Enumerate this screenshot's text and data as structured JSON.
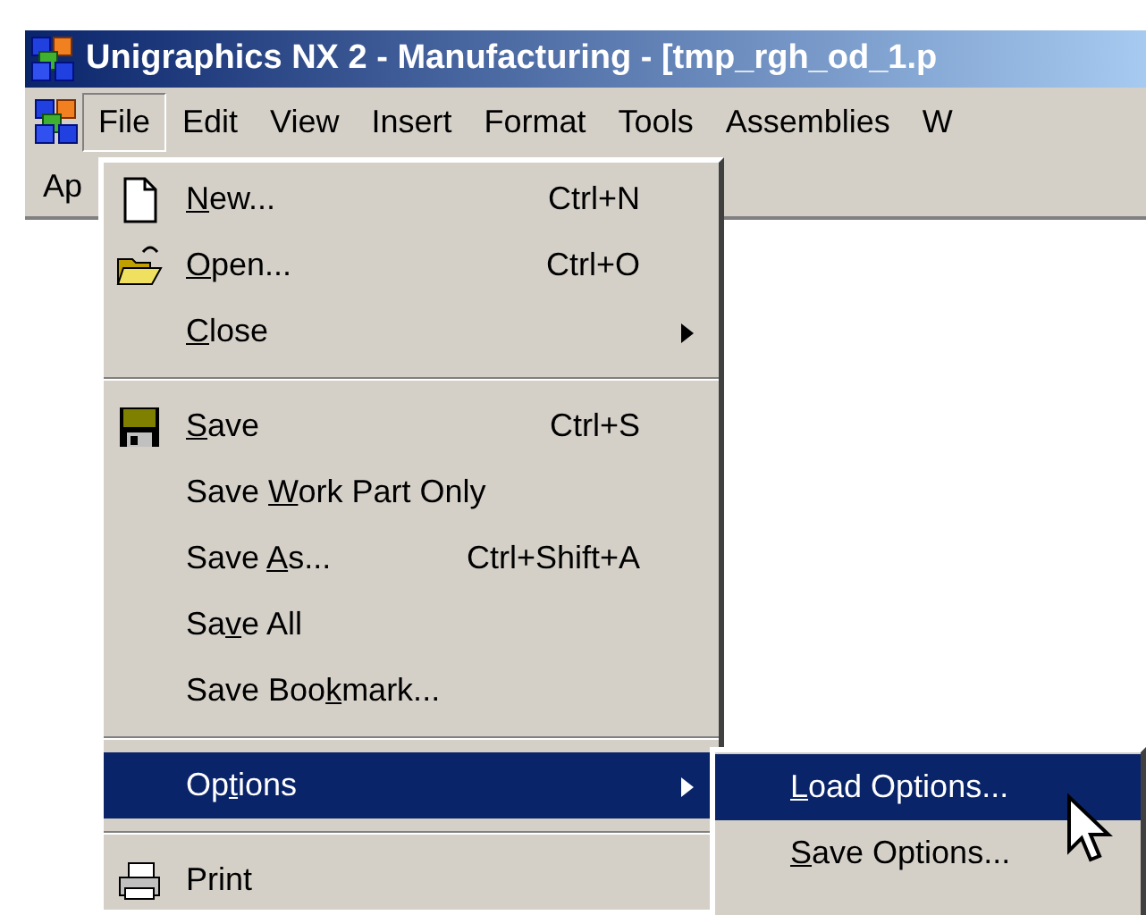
{
  "window": {
    "title": "Unigraphics NX 2 - Manufacturing - [tmp_rgh_od_1.p"
  },
  "menubar": [
    {
      "label": "File",
      "selected": true
    },
    {
      "label": "Edit",
      "selected": false
    },
    {
      "label": "View",
      "selected": false
    },
    {
      "label": "Insert",
      "selected": false
    },
    {
      "label": "Format",
      "selected": false
    },
    {
      "label": "Tools",
      "selected": false
    },
    {
      "label": "Assemblies",
      "selected": false
    },
    {
      "label": "W",
      "selected": false
    }
  ],
  "toolbar": {
    "label": "Ap"
  },
  "file_menu": [
    {
      "kind": "command",
      "label": {
        "key": "N",
        "after": "ew..."
      },
      "shortcut": "Ctrl+N",
      "selected": false
    },
    {
      "kind": "command",
      "label": {
        "key": "O",
        "after": "pen..."
      },
      "shortcut": "Ctrl+O",
      "selected": false
    },
    {
      "kind": "command",
      "label": {
        "key": "C",
        "after": "lose"
      },
      "submenu": true,
      "selected": false
    },
    {
      "kind": "separator"
    },
    {
      "kind": "command",
      "label": {
        "key": "S",
        "after": "ave"
      },
      "shortcut": "Ctrl+S",
      "selected": false
    },
    {
      "kind": "command",
      "label": {
        "before": "Save ",
        "key": "W",
        "after": "ork Part Only"
      },
      "selected": false
    },
    {
      "kind": "command",
      "label": {
        "before": "Save ",
        "key": "A",
        "after": "s..."
      },
      "shortcut": "Ctrl+Shift+A",
      "selected": false
    },
    {
      "kind": "command",
      "label": {
        "before": "Sa",
        "key": "v",
        "after": "e All"
      },
      "selected": false
    },
    {
      "kind": "command",
      "label": {
        "before": "Save Boo",
        "key": "k",
        "after": "mark..."
      },
      "selected": false
    },
    {
      "kind": "separator"
    },
    {
      "kind": "command",
      "label": {
        "before": "Op",
        "key": "t",
        "after": "ions"
      },
      "submenu": true,
      "selected": true
    },
    {
      "kind": "separator"
    },
    {
      "kind": "command",
      "label": {
        "before": "Print"
      },
      "selected": false
    }
  ],
  "options_submenu": [
    {
      "label": {
        "key": "L",
        "after": "oad Options..."
      },
      "selected": true
    },
    {
      "label": {
        "key": "S",
        "after": "ave Options..."
      },
      "selected": false
    }
  ]
}
